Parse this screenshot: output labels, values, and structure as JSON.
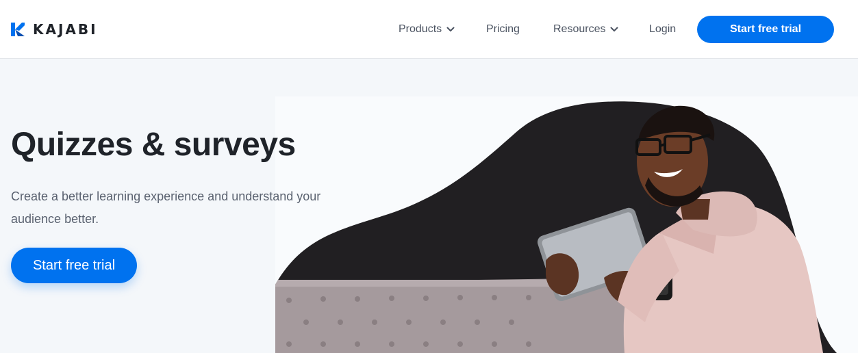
{
  "brand": {
    "name": "KAJABI",
    "logo_icon": "kajabi-k-mark",
    "accent_color": "#0072ef",
    "text_color": "#1f2329"
  },
  "nav": {
    "products": "Products",
    "pricing": "Pricing",
    "resources": "Resources",
    "login": "Login",
    "cta": "Start free trial",
    "dropdown_icon": "chevron-down-icon"
  },
  "hero": {
    "title": "Quizzes & surveys",
    "description": "Create a better learning experience and understand your audience better.",
    "cta": "Start free trial",
    "image_subject": "man in pink hoodie smiling at a tablet, seated on a grey tufted sofa against a dark blob background"
  }
}
